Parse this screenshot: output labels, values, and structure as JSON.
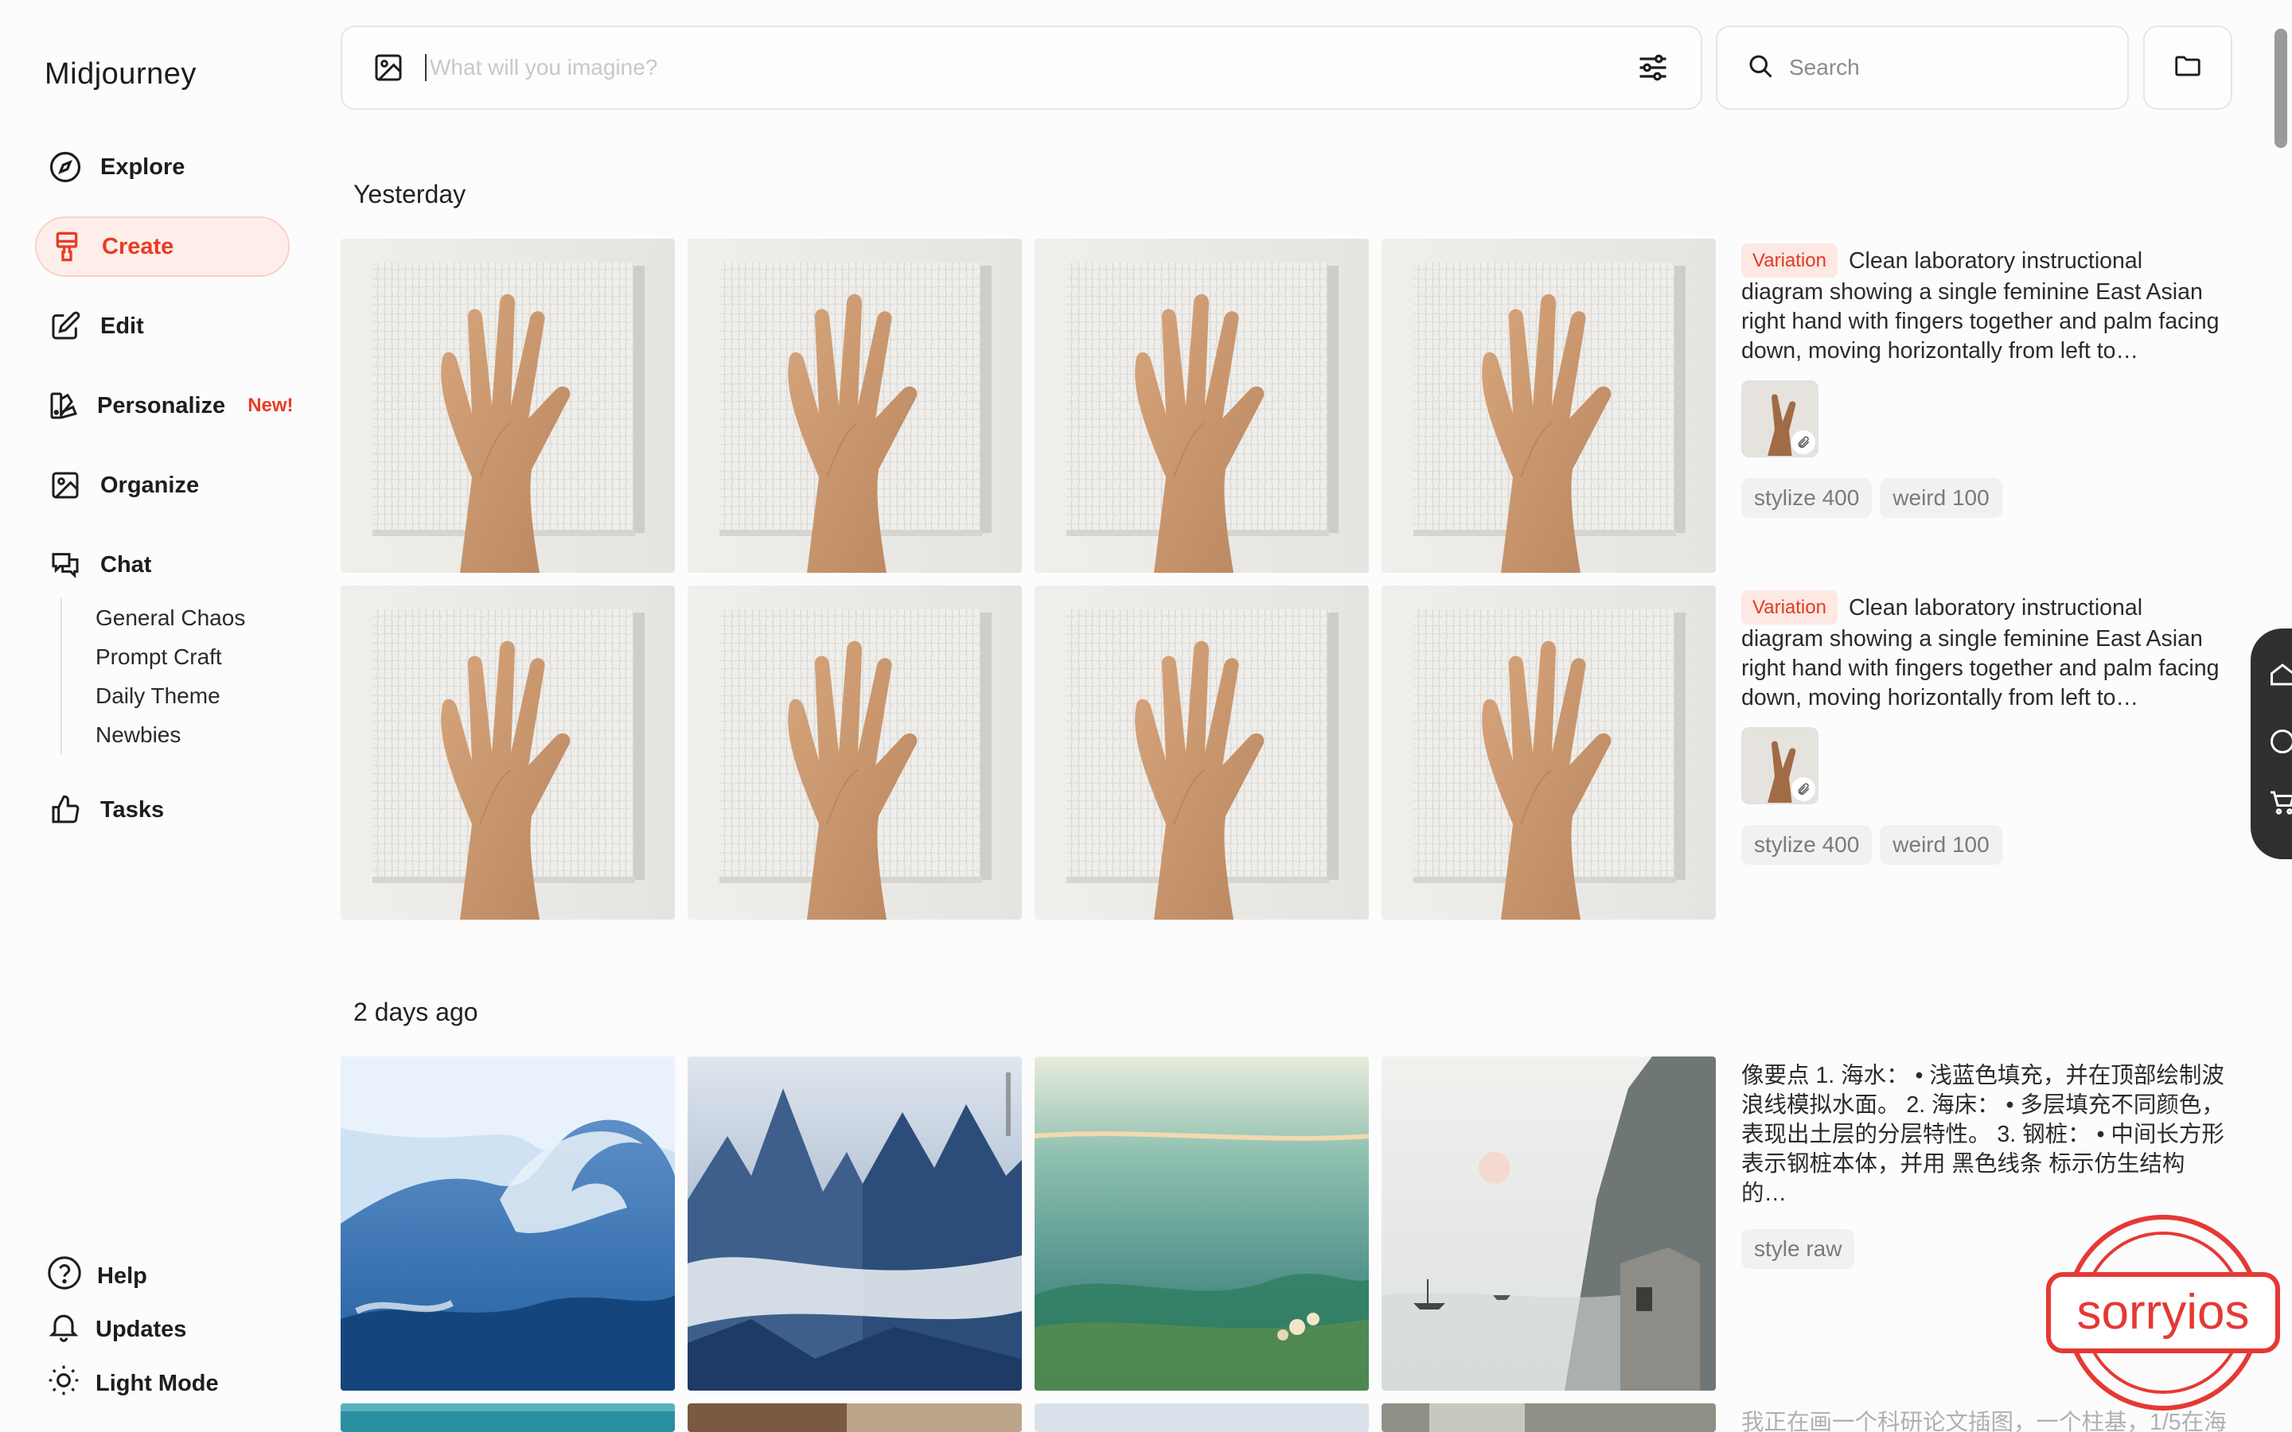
{
  "app": {
    "name": "Midjourney"
  },
  "sidebar": {
    "items": [
      {
        "label": "Explore",
        "icon": "compass-icon"
      },
      {
        "label": "Create",
        "icon": "paintbrush-icon",
        "active": true
      },
      {
        "label": "Edit",
        "icon": "edit-icon"
      },
      {
        "label": "Personalize",
        "icon": "personalize-icon",
        "badge": "New!"
      },
      {
        "label": "Organize",
        "icon": "image-icon"
      },
      {
        "label": "Chat",
        "icon": "chat-icon"
      },
      {
        "label": "Tasks",
        "icon": "thumbs-up-icon"
      }
    ],
    "chat_rooms": [
      "General Chaos",
      "Prompt Craft",
      "Daily Theme",
      "Newbies"
    ],
    "bottom": [
      {
        "label": "Help",
        "icon": "help-icon"
      },
      {
        "label": "Updates",
        "icon": "bell-icon"
      },
      {
        "label": "Light Mode",
        "icon": "sun-icon"
      }
    ]
  },
  "topbar": {
    "prompt_placeholder": "What will you imagine?",
    "search_placeholder": "Search"
  },
  "sections": [
    {
      "heading": "Yesterday",
      "jobs": [
        {
          "tag": "Variation",
          "description": "Clean laboratory instructional diagram showing a single feminine East Asian right hand with fingers together and palm facing down, moving horizontally from left to…",
          "params": [
            "stylize 400",
            "weird 100"
          ]
        },
        {
          "tag": "Variation",
          "description": "Clean laboratory instructional diagram showing a single feminine East Asian right hand with fingers together and palm facing down, moving horizontally from left to…",
          "params": [
            "stylize 400",
            "weird 100"
          ]
        }
      ]
    },
    {
      "heading": "2 days ago",
      "jobs": [
        {
          "description": "像要点 1. 海水： • 浅蓝色填充，并在顶部绘制波浪线模拟水面。 2. 海床： • 多层填充不同颜色，表现出土层的分层特性。 3. 钢桩： • 中间长方形表示钢桩本体，并用 黑色线条 标示仿生结构的…",
          "params": [
            "style raw"
          ]
        },
        {
          "description": "我正在画一个科研论文插图，一个柱基，1/5在海"
        }
      ]
    }
  ],
  "watermark": {
    "text": "sorryios"
  },
  "colors": {
    "accent": "#ea3b23",
    "accent_bg": "#fdeeea"
  }
}
